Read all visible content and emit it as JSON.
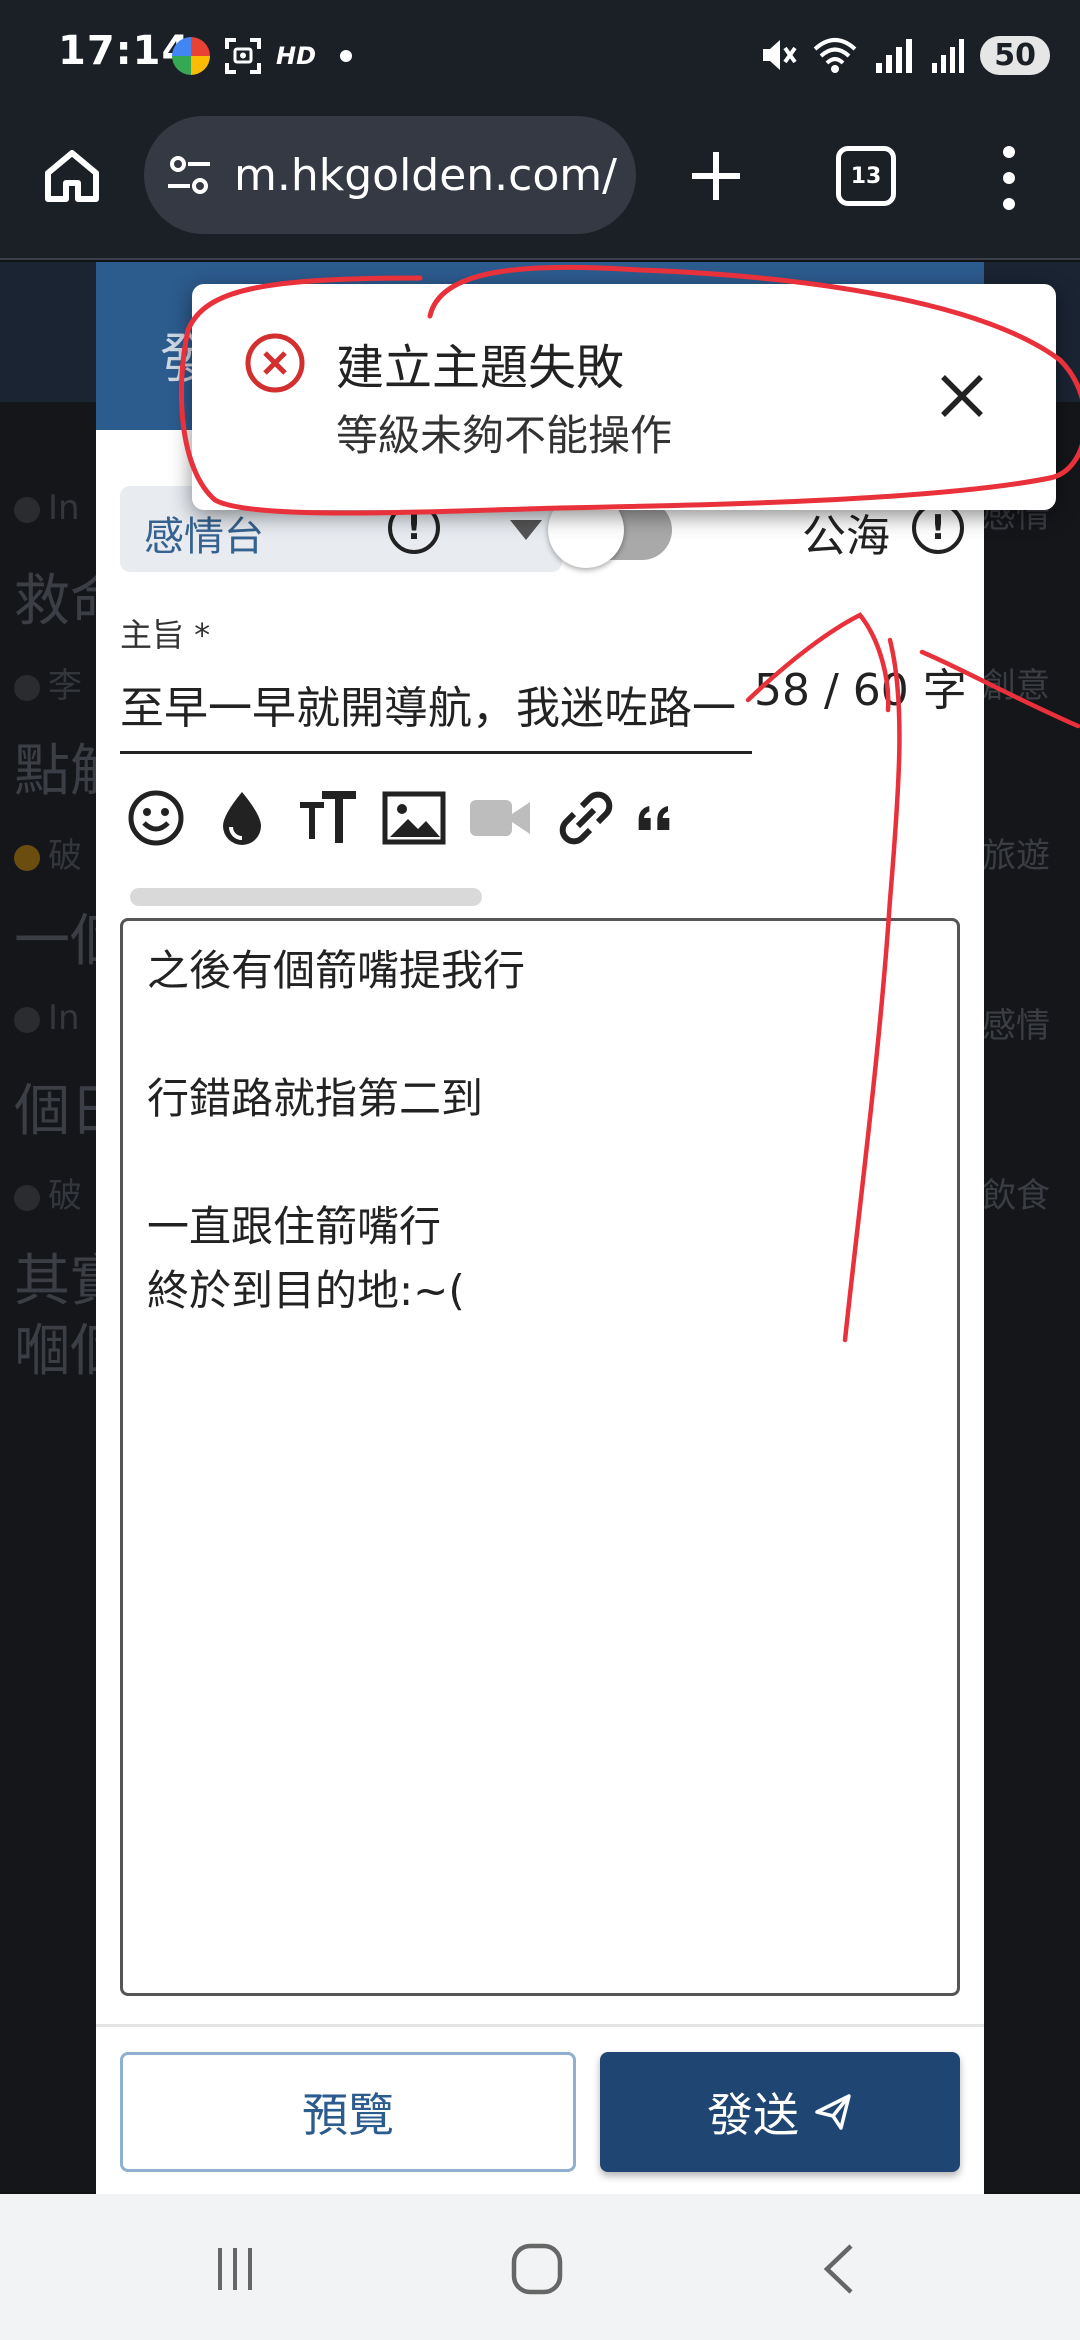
{
  "status_bar": {
    "time": "17:14",
    "hd_label": "HD",
    "battery": "50",
    "icons": [
      "color-wheel-icon",
      "screenshot-icon",
      "mute-icon",
      "wifi-icon",
      "signal-icon"
    ]
  },
  "browser": {
    "url": "m.hkgolden.com/",
    "tab_count": "13"
  },
  "background_page": {
    "posts": [
      {
        "meta": "In",
        "category": "感情",
        "title": "救命"
      },
      {
        "meta": "李",
        "category": "創意",
        "title": "點解"
      },
      {
        "meta": "破",
        "category": "旅遊",
        "title": "一個"
      },
      {
        "meta": "In",
        "category": "感情",
        "title": "個日"
      },
      {
        "meta": "破",
        "category": "飲食",
        "title": "其實",
        "title_line2": "嗰個"
      }
    ]
  },
  "dialog": {
    "header_title": "發",
    "forum_select_value": "感情台",
    "public_label": "公海",
    "subject_label": "主旨 *",
    "subject_value": "至早一早就開導航，我迷咗路一",
    "char_count": "58 / 60 字",
    "body_lines": [
      "之後有個箭嘴提我行",
      "",
      "行錯路就指第二到",
      "",
      "一直跟住箭嘴行",
      "終於到目的地:~("
    ],
    "preview_label": "預覽",
    "send_label": "發送"
  },
  "toast": {
    "title": "建立主題失敗",
    "message": "等級未夠不能操作"
  },
  "colors": {
    "header_blue": "#2c5b8e",
    "send_blue": "#1f4672",
    "error_red": "#d32f2f",
    "annotation_red": "#e8313a"
  }
}
